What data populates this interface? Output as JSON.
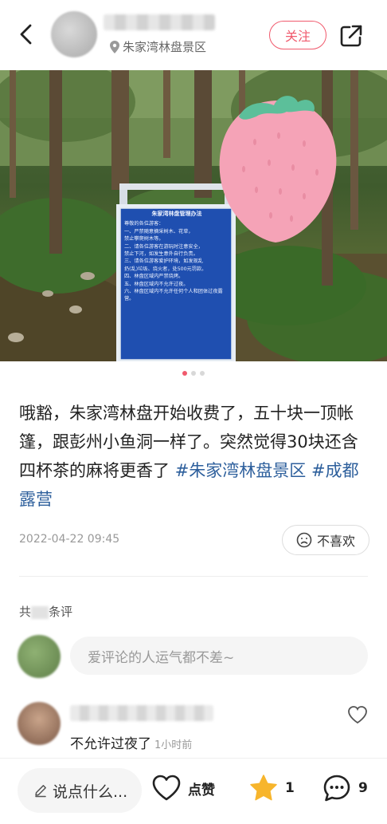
{
  "header": {
    "location": "朱家湾林盘景区",
    "follow_label": "关注",
    "icons": [
      "back-arrow-icon",
      "location-pin-icon",
      "share-icon"
    ]
  },
  "post": {
    "text_main": "哦豁，朱家湾林盘开始收费了，五十块一顶帐篷，跟彭州小鱼洞一样了。突然觉得30块还含四杯茶的麻将更香了 ",
    "tags": [
      "#朱家湾林盘景区",
      "#成都露营"
    ],
    "date": "2022-04-22 09:45",
    "dislike_label": "不喜欢",
    "image_pager": {
      "total": 3,
      "current": 1
    },
    "photo_sign": {
      "title": "朱家湾林盘管理办法",
      "greeting": "尊敬的各位游客：",
      "lines": [
        "一、严禁随意摘采树木、花草，",
        "禁止攀爬树木等。",
        "二、请各位游客在游玩时注意安全，",
        "禁止下河，如发生意外自行负责。",
        "三、请各位游客爱护环境，如发现乱",
        "扔(乱)垃圾、烧火者，处500元罚款。",
        "四、林盘区域内严禁烧烤。",
        "五、林盘区域内不允许过夜。",
        "六、林盘区域内不允许任何个人和团体过夜露营。"
      ]
    }
  },
  "comments": {
    "count_prefix": "共",
    "count_suffix": "条评",
    "input_placeholder": "爱评论的人运气都不差~",
    "items": [
      {
        "text": "不允许过夜了",
        "time": "1小时前"
      }
    ]
  },
  "bottom_bar": {
    "say_placeholder": "说点什么...",
    "like_label": "点赞",
    "star_count": "1",
    "comment_count": "9"
  },
  "colors": {
    "accent": "#f05a6d",
    "tag": "#2d5f9c",
    "star": "#f7b52c"
  }
}
